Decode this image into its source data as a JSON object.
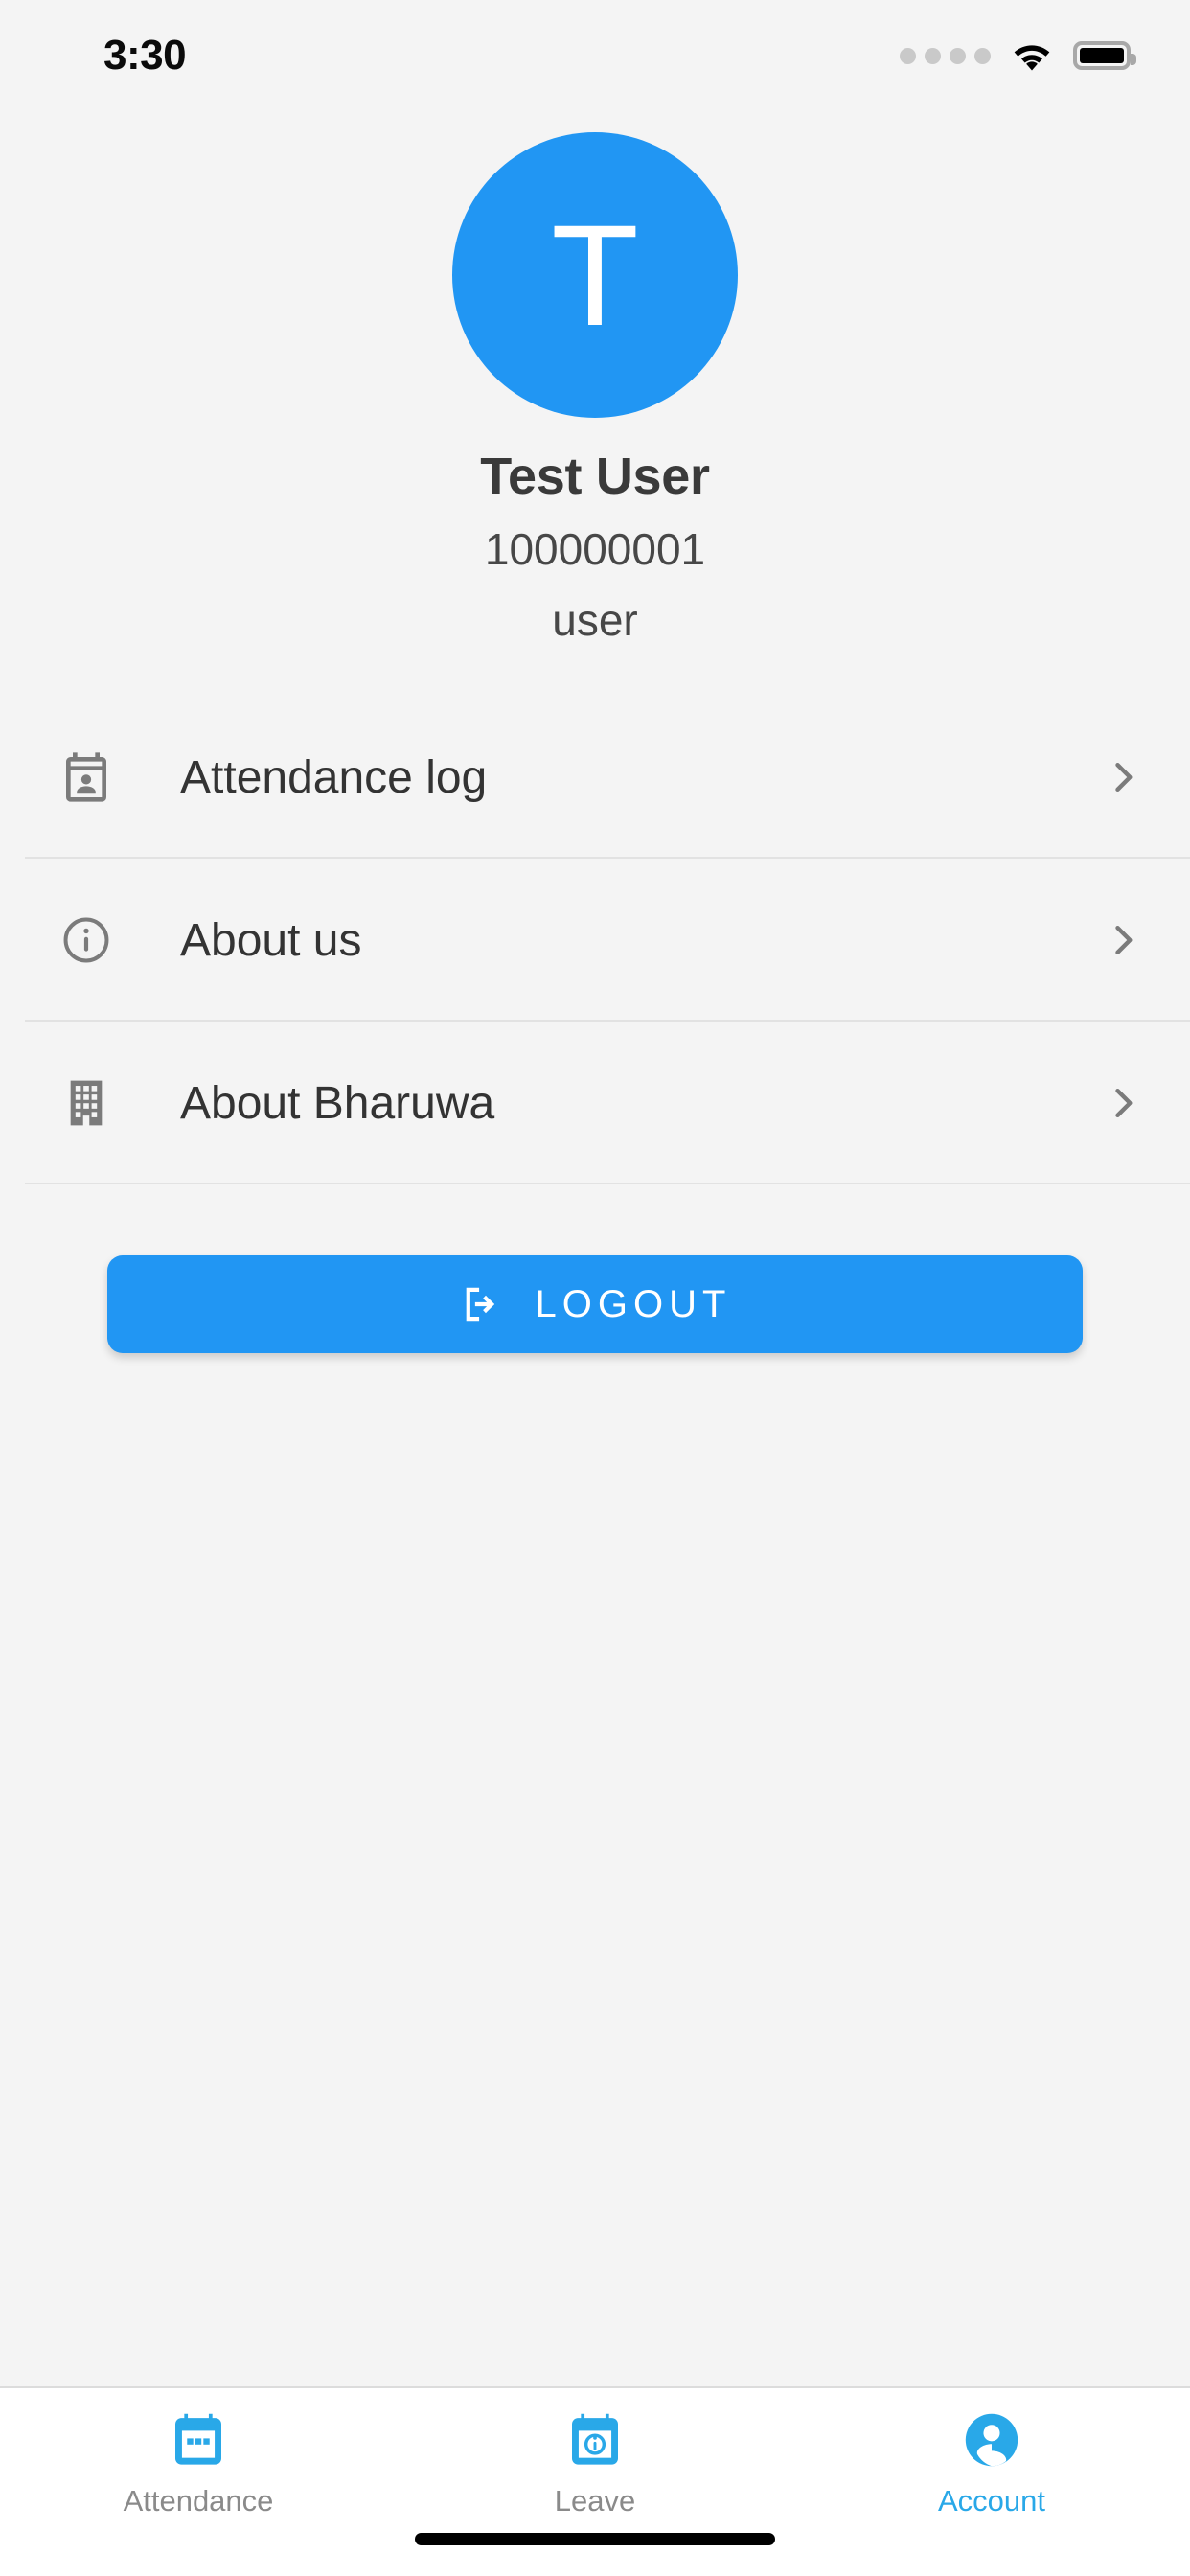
{
  "status_bar": {
    "time": "3:30",
    "signal_icon": "signal-dots-icon",
    "wifi_icon": "wifi-icon",
    "battery_icon": "battery-full-icon"
  },
  "profile": {
    "avatar_initial": "T",
    "avatar_color": "#2196f3",
    "name": "Test User",
    "id": "100000001",
    "role": "user"
  },
  "menu": {
    "items": [
      {
        "label": "Attendance log",
        "icon": "perm-contact-calendar-icon",
        "chevron": "chevron-right-icon"
      },
      {
        "label": "About us",
        "icon": "info-circle-outline-icon",
        "chevron": "chevron-right-icon"
      },
      {
        "label": "About Bharuwa",
        "icon": "building-icon",
        "chevron": "chevron-right-icon"
      }
    ]
  },
  "logout": {
    "label": "LOGOUT",
    "icon": "logout-icon",
    "color": "#2196f3"
  },
  "tabbar": {
    "active_color": "#29a8e8",
    "inactive_color": "#8a8a8a",
    "tabs": [
      {
        "label": "Attendance",
        "icon": "calendar-icon",
        "active": false
      },
      {
        "label": "Leave",
        "icon": "calendar-info-icon",
        "active": false
      },
      {
        "label": "Account",
        "icon": "account-circle-icon",
        "active": true
      }
    ]
  },
  "home_indicator": "home-indicator"
}
